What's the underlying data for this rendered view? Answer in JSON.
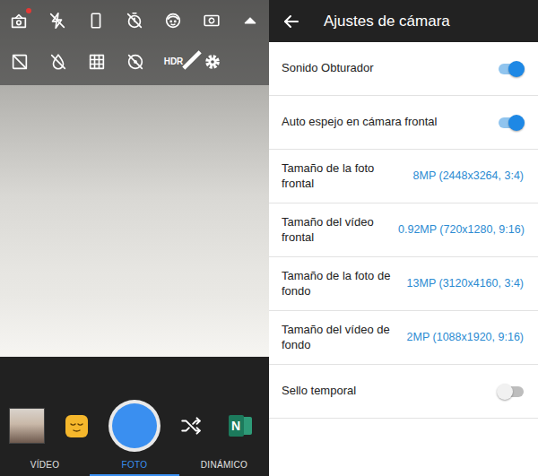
{
  "camera": {
    "toolbar": [
      [
        {
          "kind": "mode",
          "badge": true
        },
        {
          "kind": "flashoff",
          "badge": false
        },
        {
          "kind": "ratio",
          "badge": false
        },
        {
          "kind": "timeroff",
          "badge": false
        },
        {
          "kind": "face",
          "badge": false
        },
        {
          "kind": "switch",
          "badge": false
        },
        {
          "kind": "collapse",
          "badge": false
        }
      ],
      [
        {
          "kind": "gridoff",
          "badge": false
        },
        {
          "kind": "dropoff",
          "badge": false
        },
        {
          "kind": "grid",
          "badge": false
        },
        {
          "kind": "focusoff",
          "badge": false
        },
        {
          "kind": "hdroff",
          "badge": false,
          "label": "HDR"
        },
        {
          "kind": "settings",
          "badge": false
        }
      ]
    ],
    "logo_text": "N",
    "modes": [
      {
        "label": "VÍDEO",
        "selected": false
      },
      {
        "label": "FOTO",
        "selected": true
      },
      {
        "label": "DINÁMICO",
        "selected": false
      }
    ]
  },
  "settings": {
    "title": "Ajustes de cámara",
    "items": [
      {
        "kind": "toggle",
        "label": "Sonido Obturador",
        "on": true
      },
      {
        "kind": "toggle",
        "label": "Auto espejo en cámara frontal",
        "on": true
      },
      {
        "kind": "value",
        "label": "Tamaño de la foto frontal",
        "value": "8MP (2448x3264, 3:4)"
      },
      {
        "kind": "value",
        "label": "Tamaño del vídeo frontal",
        "value": "0.92MP (720x1280, 9:16)"
      },
      {
        "kind": "value",
        "label": "Tamaño de la foto de fondo",
        "value": "13MP (3120x4160, 3:4)"
      },
      {
        "kind": "value",
        "label": "Tamaño del vídeo de fondo",
        "value": "2MP (1088x1920, 9:16)"
      },
      {
        "kind": "toggle",
        "label": "Sello temporal",
        "on": false
      }
    ]
  }
}
